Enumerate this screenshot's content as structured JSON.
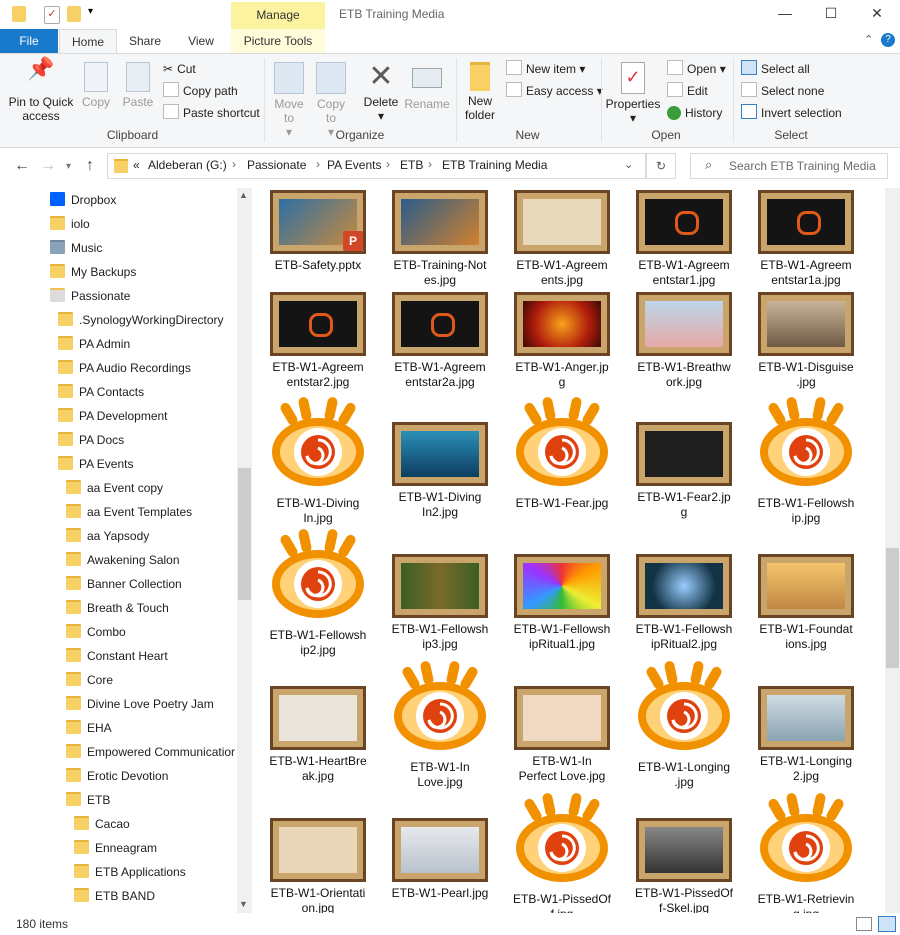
{
  "window": {
    "title": "ETB Training Media",
    "context_tab": "Manage",
    "minimize": "—",
    "maximize": "☐",
    "close": "✕"
  },
  "tabs": {
    "file": "File",
    "home": "Home",
    "share": "Share",
    "view": "View",
    "picture_tools": "Picture Tools"
  },
  "ribbon": {
    "clipboard": {
      "label": "Clipboard",
      "pin": "Pin to Quick access",
      "copy": "Copy",
      "paste": "Paste",
      "cut": "Cut",
      "copy_path": "Copy path",
      "paste_shortcut": "Paste shortcut"
    },
    "organize": {
      "label": "Organize",
      "move_to": "Move to",
      "copy_to": "Copy to",
      "delete": "Delete",
      "rename": "Rename"
    },
    "new": {
      "label": "New",
      "new_folder": "New folder",
      "new_item": "New item",
      "easy_access": "Easy access"
    },
    "open": {
      "label": "Open",
      "properties": "Properties",
      "open": "Open",
      "edit": "Edit",
      "history": "History"
    },
    "select": {
      "label": "Select",
      "select_all": "Select all",
      "select_none": "Select none",
      "invert": "Invert selection"
    }
  },
  "address": {
    "crumbs": [
      "Aldeberan (G:)",
      "Passionate",
      "PA Events",
      "ETB",
      "ETB Training Media"
    ],
    "overflow": "«",
    "search_placeholder": "Search ETB Training Media"
  },
  "nav": {
    "items": [
      {
        "label": "Dropbox",
        "indent": 0,
        "kind": "dropbox"
      },
      {
        "label": "iolo",
        "indent": 0,
        "kind": "folder"
      },
      {
        "label": "Music",
        "indent": 0,
        "kind": "music"
      },
      {
        "label": "My Backups",
        "indent": 0,
        "kind": "folder"
      },
      {
        "label": "Passionate",
        "indent": 0,
        "kind": "drive-folder"
      },
      {
        "label": ".SynologyWorkingDirectory",
        "indent": 1,
        "kind": "folder"
      },
      {
        "label": "PA Admin",
        "indent": 1,
        "kind": "folder"
      },
      {
        "label": "PA Audio Recordings",
        "indent": 1,
        "kind": "folder"
      },
      {
        "label": "PA Contacts",
        "indent": 1,
        "kind": "folder"
      },
      {
        "label": "PA Development",
        "indent": 1,
        "kind": "folder"
      },
      {
        "label": "PA Docs",
        "indent": 1,
        "kind": "folder"
      },
      {
        "label": "PA Events",
        "indent": 1,
        "kind": "folder"
      },
      {
        "label": "aa Event copy",
        "indent": 2,
        "kind": "folder"
      },
      {
        "label": "aa Event Templates",
        "indent": 2,
        "kind": "folder"
      },
      {
        "label": "aa Yapsody",
        "indent": 2,
        "kind": "folder"
      },
      {
        "label": "Awakening Salon",
        "indent": 2,
        "kind": "folder"
      },
      {
        "label": "Banner Collection",
        "indent": 2,
        "kind": "folder"
      },
      {
        "label": "Breath & Touch",
        "indent": 2,
        "kind": "folder"
      },
      {
        "label": "Combo",
        "indent": 2,
        "kind": "folder"
      },
      {
        "label": "Constant Heart",
        "indent": 2,
        "kind": "folder"
      },
      {
        "label": "Core",
        "indent": 2,
        "kind": "folder"
      },
      {
        "label": "Divine Love Poetry Jam",
        "indent": 2,
        "kind": "folder"
      },
      {
        "label": "EHA",
        "indent": 2,
        "kind": "folder"
      },
      {
        "label": "Empowered Communicatior",
        "indent": 2,
        "kind": "folder"
      },
      {
        "label": "Erotic Devotion",
        "indent": 2,
        "kind": "folder"
      },
      {
        "label": "ETB",
        "indent": 2,
        "kind": "folder"
      },
      {
        "label": "Cacao",
        "indent": 3,
        "kind": "folder"
      },
      {
        "label": "Enneagram",
        "indent": 3,
        "kind": "folder"
      },
      {
        "label": "ETB Applications",
        "indent": 3,
        "kind": "folder"
      },
      {
        "label": "ETB BAND",
        "indent": 3,
        "kind": "folder"
      }
    ]
  },
  "files": [
    {
      "name": "ETB-Safety.pptx",
      "thumb": "slide-safety"
    },
    {
      "name": "ETB-Training-Notes.jpg",
      "thumb": "slide-notes"
    },
    {
      "name": "ETB-W1-Agreements.jpg",
      "thumb": "slide-agreements"
    },
    {
      "name": "ETB-W1-Agreementstar1.jpg",
      "thumb": "slide-dark"
    },
    {
      "name": "ETB-W1-Agreementstar1a.jpg",
      "thumb": "slide-dark"
    },
    {
      "name": "ETB-W1-Agreementstar2.jpg",
      "thumb": "slide-dark"
    },
    {
      "name": "ETB-W1-Agreementstar2a.jpg",
      "thumb": "slide-dark"
    },
    {
      "name": "ETB-W1-Anger.jpg",
      "thumb": "slide-anger"
    },
    {
      "name": "ETB-W1-Breathwork.jpg",
      "thumb": "slide-breath"
    },
    {
      "name": "ETB-W1-Disguise.jpg",
      "thumb": "slide-disguise"
    },
    {
      "name": "ETB-W1-DivingIn.jpg",
      "thumb": "xnview"
    },
    {
      "name": "ETB-W1-DivingIn2.jpg",
      "thumb": "slide-diving"
    },
    {
      "name": "ETB-W1-Fear.jpg",
      "thumb": "xnview"
    },
    {
      "name": "ETB-W1-Fear2.jpg",
      "thumb": "slide-fear"
    },
    {
      "name": "ETB-W1-Fellowship.jpg",
      "thumb": "xnview"
    },
    {
      "name": "ETB-W1-Fellowship2.jpg",
      "thumb": "xnview"
    },
    {
      "name": "ETB-W1-Fellowship3.jpg",
      "thumb": "slide-fellow3"
    },
    {
      "name": "ETB-W1-FellowshipRitual1.jpg",
      "thumb": "slide-ritual1"
    },
    {
      "name": "ETB-W1-FellowshipRitual2.jpg",
      "thumb": "slide-ritual2"
    },
    {
      "name": "ETB-W1-Foundations.jpg",
      "thumb": "slide-found"
    },
    {
      "name": "ETB-W1-HeartBreak.jpg",
      "thumb": "slide-heart"
    },
    {
      "name": "ETB-W1-In Love.jpg",
      "thumb": "xnview"
    },
    {
      "name": "ETB-W1-In Perfect Love.jpg",
      "thumb": "slide-perfect"
    },
    {
      "name": "ETB-W1-Longing.jpg",
      "thumb": "xnview"
    },
    {
      "name": "ETB-W1-Longing2.jpg",
      "thumb": "slide-longing"
    },
    {
      "name": "ETB-W1-Orientation.jpg",
      "thumb": "slide-orient"
    },
    {
      "name": "ETB-W1-Pearl.jpg",
      "thumb": "slide-pearl"
    },
    {
      "name": "ETB-W1-PissedOff.jpg",
      "thumb": "xnview"
    },
    {
      "name": "ETB-W1-PissedOff-Skel.jpg",
      "thumb": "slide-skel"
    },
    {
      "name": "ETB-W1-Retrieving.jpg",
      "thumb": "xnview"
    }
  ],
  "labels": [
    [
      "ETB-Safety.pptx"
    ],
    [
      "ETB-Training-Not",
      "es.jpg"
    ],
    [
      "ETB-W1-Agreem",
      "ents.jpg"
    ],
    [
      "ETB-W1-Agreem",
      "entstar1.jpg"
    ],
    [
      "ETB-W1-Agreem",
      "entstar1a.jpg"
    ],
    [
      "ETB-W1-Agreem",
      "entstar2.jpg"
    ],
    [
      "ETB-W1-Agreem",
      "entstar2a.jpg"
    ],
    [
      "ETB-W1-Anger.jp",
      "g"
    ],
    [
      "ETB-W1-Breathw",
      "ork.jpg"
    ],
    [
      "ETB-W1-Disguise",
      ".jpg"
    ],
    [
      "ETB-W1-Diving",
      "In.jpg"
    ],
    [
      "ETB-W1-Diving",
      "In2.jpg"
    ],
    [
      "ETB-W1-Fear.jpg"
    ],
    [
      "ETB-W1-Fear2.jp",
      "g"
    ],
    [
      "ETB-W1-Fellowsh",
      "ip.jpg"
    ],
    [
      "ETB-W1-Fellowsh",
      "ip2.jpg"
    ],
    [
      "ETB-W1-Fellowsh",
      "ip3.jpg"
    ],
    [
      "ETB-W1-Fellowsh",
      "ipRitual1.jpg"
    ],
    [
      "ETB-W1-Fellowsh",
      "ipRitual2.jpg"
    ],
    [
      "ETB-W1-Foundat",
      "ions.jpg"
    ],
    [
      "ETB-W1-HeartBre",
      "ak.jpg"
    ],
    [
      "ETB-W1-In",
      "Love.jpg"
    ],
    [
      "ETB-W1-In",
      "Perfect Love.jpg"
    ],
    [
      "ETB-W1-Longing",
      ".jpg"
    ],
    [
      "ETB-W1-Longing",
      "2.jpg"
    ],
    [
      "ETB-W1-Orientati",
      "on.jpg"
    ],
    [
      "ETB-W1-Pearl.jpg"
    ],
    [
      "ETB-W1-PissedOf",
      "f.jpg"
    ],
    [
      "ETB-W1-PissedOf",
      "f-Skel.jpg"
    ],
    [
      "ETB-W1-Retrievin",
      "g.jpg"
    ]
  ],
  "status": {
    "count": "180 items"
  },
  "colors": {
    "accent": "#1979ca",
    "manage": "#fcf3a1",
    "folder": "#f7d066",
    "frame": "#6b4423",
    "xnview_orange": "#f28a00"
  }
}
